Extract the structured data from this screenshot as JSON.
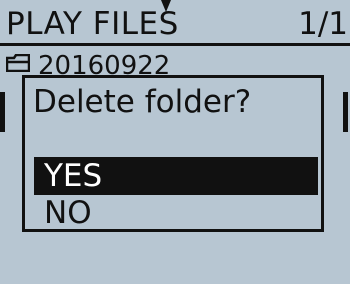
{
  "header": {
    "title": "PLAY FILES",
    "page_indicator": "1/1"
  },
  "list": {
    "folder_icon": "folder-icon",
    "folder_name": "20160922"
  },
  "dialog": {
    "message": "Delete folder?",
    "options": [
      {
        "label": "YES",
        "selected": true
      },
      {
        "label": "NO",
        "selected": false
      }
    ]
  },
  "colors": {
    "background": "#b7c6d2",
    "foreground": "#111111",
    "highlight_text": "#ffffff"
  }
}
